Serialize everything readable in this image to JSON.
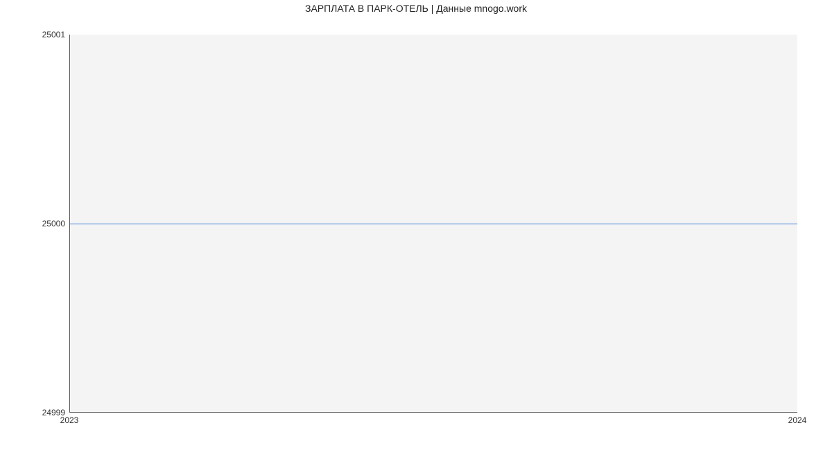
{
  "chart_data": {
    "type": "line",
    "title": "ЗАРПЛАТА В ПАРК-ОТЕЛЬ | Данные mnogo.work",
    "xlabel": "",
    "ylabel": "",
    "x": [
      2023,
      2024
    ],
    "y": [
      25000,
      25000
    ],
    "categories": [
      "2023",
      "2024"
    ],
    "ylim": [
      24999,
      25001
    ],
    "y_ticks": [
      24999,
      25000,
      25001
    ],
    "y_tick_labels": [
      "24999",
      "25000",
      "25001"
    ],
    "x_tick_labels": [
      "2023",
      "2024"
    ],
    "line_color": "#3b7bd4",
    "grid": false
  }
}
